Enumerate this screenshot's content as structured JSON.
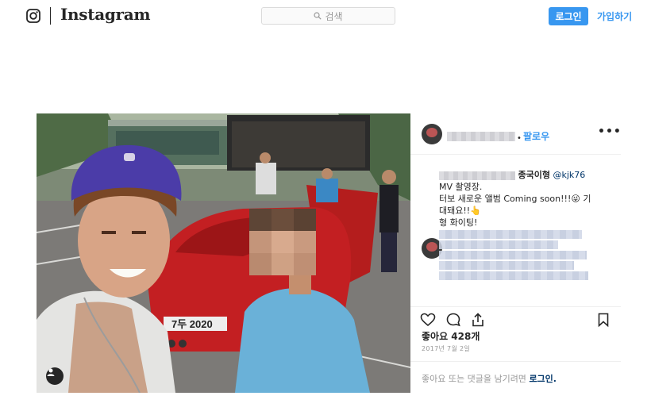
{
  "header": {
    "brand": "Instagram",
    "search_placeholder": "검색",
    "login_label": "로그인",
    "signup_label": "가입하기"
  },
  "post": {
    "follow_label": "팔로우",
    "more_label": "•••",
    "caption": {
      "user": "종국이형",
      "handle": "@kjk76",
      "line1": "MV 촬영장.",
      "line2": "터보 새로운 앨범 Coming soon!!!😜 기",
      "line3": "대돼요!!👆",
      "line4": "형 화이팅!"
    },
    "likes": "좋아요 428개",
    "date": "2017년 7월 2일",
    "comment_prompt": "좋아요 또는 댓글을 남기려면",
    "comment_login": "로그인.",
    "license_plate": "7두 2020",
    "icons": [
      "heart-icon",
      "comment-icon",
      "share-icon",
      "bookmark-icon",
      "user-tag-icon"
    ]
  },
  "colors": {
    "accent": "#3897f0",
    "text": "#262626",
    "muted": "#999999",
    "border": "#efefef"
  }
}
